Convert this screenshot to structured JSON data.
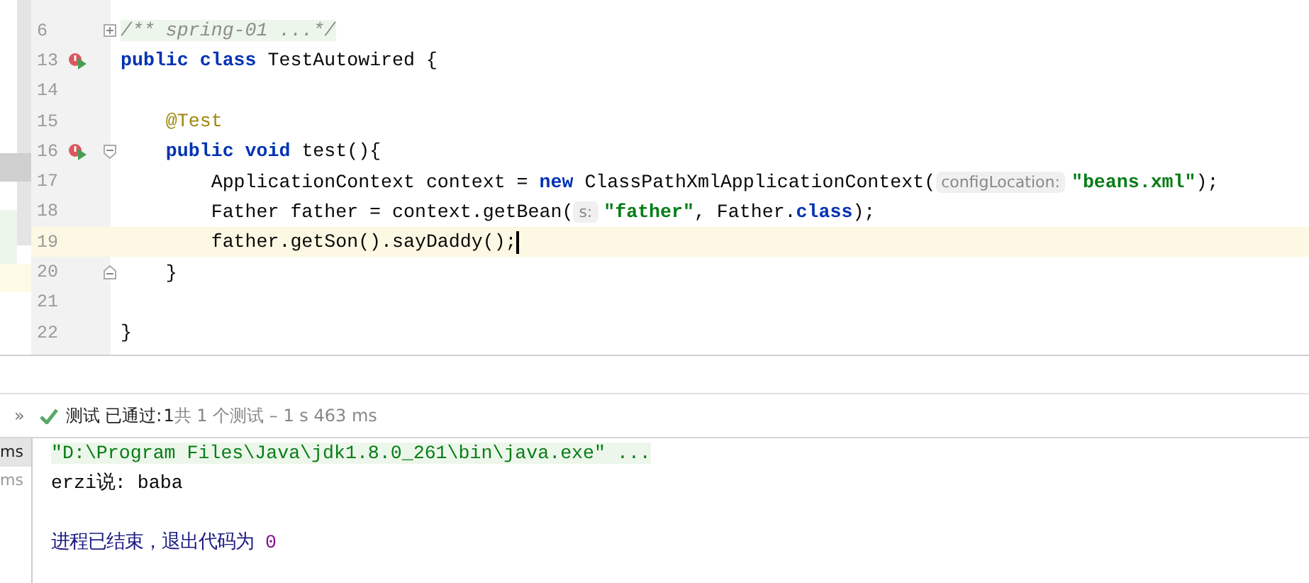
{
  "editor": {
    "lines": [
      {
        "number": "6",
        "folded": true,
        "fold_start": false,
        "fold_end": false,
        "tokens": [
          {
            "kind": "comment",
            "text": "/** spring-01 ...*/"
          }
        ]
      },
      {
        "number": "13",
        "run": true,
        "folded": false,
        "fold_start": false,
        "fold_end": false,
        "tokens": [
          {
            "kind": "keyword",
            "text": "public class"
          },
          {
            "kind": "plain",
            "text": " TestAutowired {"
          }
        ]
      },
      {
        "number": "14",
        "folded": false,
        "fold_start": false,
        "fold_end": false
      },
      {
        "number": "15",
        "folded": false,
        "fold_start": false,
        "fold_end": false,
        "tokens": [
          {
            "kind": "annotation",
            "text": "    @Test"
          }
        ]
      },
      {
        "number": "16",
        "run": true,
        "folded": false,
        "fold_start": true,
        "fold_end": false,
        "tokens": [
          {
            "kind": "keyword",
            "text": "    public void"
          },
          {
            "kind": "plain",
            "text": " test(){"
          }
        ]
      },
      {
        "number": "17",
        "folded": false,
        "fold_start": false,
        "fold_end": false,
        "tokens": [
          {
            "kind": "plain",
            "text": "        ApplicationContext context = "
          },
          {
            "kind": "keyword",
            "text": "new"
          },
          {
            "kind": "plain",
            "text": " ClassPathXmlApplicationContext("
          },
          {
            "kind": "hint",
            "text": "configLocation:"
          },
          {
            "kind": "string",
            "text": "\"beans.xml\""
          },
          {
            "kind": "plain",
            "text": ");"
          }
        ]
      },
      {
        "number": "18",
        "folded": false,
        "fold_start": false,
        "fold_end": false,
        "tokens": [
          {
            "kind": "plain",
            "text": "        Father father = context.getBean("
          },
          {
            "kind": "hint",
            "text": "s:"
          },
          {
            "kind": "string",
            "text": "\"father\""
          },
          {
            "kind": "plain",
            "text": ", Father."
          },
          {
            "kind": "keyword",
            "text": "class"
          },
          {
            "kind": "plain",
            "text": ");"
          }
        ]
      },
      {
        "number": "19",
        "current": true,
        "folded": false,
        "fold_start": false,
        "fold_end": false,
        "tokens": [
          {
            "kind": "plain",
            "text": "        father.getSon().sayDaddy();"
          }
        ]
      },
      {
        "number": "20",
        "folded": false,
        "fold_start": false,
        "fold_end": true,
        "tokens": [
          {
            "kind": "plain",
            "text": "    }"
          }
        ]
      },
      {
        "number": "21",
        "folded": false,
        "fold_start": false,
        "fold_end": false
      },
      {
        "number": "22",
        "folded": false,
        "fold_start": false,
        "fold_end": false,
        "tokens": [
          {
            "kind": "plain",
            "text": "}"
          }
        ]
      }
    ]
  },
  "run_bar": {
    "expand": "»",
    "status": "测试 已通过:",
    "passed": "1",
    "summary": "共 1 个测试 – 1 s 463 ms"
  },
  "test_tree": [
    {
      "duration": "ms",
      "selected": true
    },
    {
      "duration": "ms",
      "selected": false
    }
  ],
  "console": [
    {
      "kind": "command",
      "tokens": [
        {
          "kind": "string",
          "text": "\"D:\\Program Files\\Java\\jdk1.8.0_261\\bin\\java.exe\" ..."
        }
      ]
    },
    {
      "kind": "output",
      "tokens": [
        {
          "kind": "plain",
          "text": "erzi说: baba"
        }
      ]
    },
    {
      "kind": "blank"
    },
    {
      "kind": "system",
      "tokens": [
        {
          "kind": "system",
          "text": "进程已结束，退出代码为 "
        },
        {
          "kind": "number",
          "text": "0"
        }
      ]
    }
  ]
}
